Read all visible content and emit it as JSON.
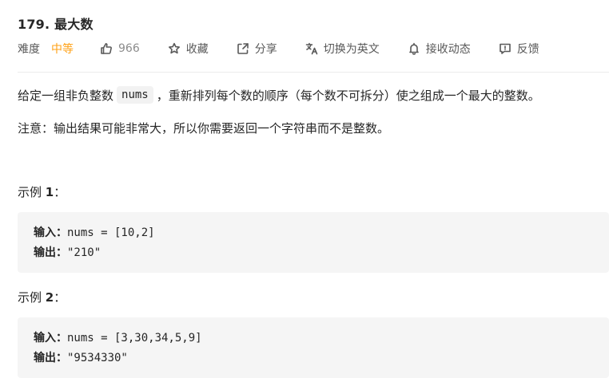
{
  "problem": {
    "title": "179. 最大数"
  },
  "toolbar": {
    "difficulty_label": "难度",
    "difficulty_value": "中等",
    "like_count": "966",
    "favorite_label": "收藏",
    "share_label": "分享",
    "translate_label": "切换为英文",
    "subscribe_label": "接收动态",
    "feedback_label": "反馈"
  },
  "description": {
    "part1": "给定一组非负整数",
    "code": "nums",
    "part2": "，重新排列每个数的顺序（每个数不可拆分）使之组成一个最大的整数。",
    "note": "注意：输出结果可能非常大，所以你需要返回一个字符串而不是整数。"
  },
  "examples": [
    {
      "title_prefix": "示例 ",
      "title_num": "1",
      "title_suffix": "：",
      "input_label": "输入：",
      "input_value": "nums = [10,2]",
      "output_label": "输出：",
      "output_value": "\"210\""
    },
    {
      "title_prefix": "示例 ",
      "title_num": "2",
      "title_suffix": "：",
      "input_label": "输入：",
      "input_value": "nums = [3,30,34,5,9]",
      "output_label": "输出：",
      "output_value": "\"9534330\""
    }
  ],
  "icons": {
    "like": "thumbs-up-icon",
    "favorite": "star-icon",
    "share": "share-icon",
    "translate": "translate-icon",
    "subscribe": "bell-icon",
    "feedback": "feedback-icon"
  },
  "colors": {
    "difficulty_medium": "#ffa116",
    "text": "#262626",
    "muted": "#595959",
    "code_bg": "#f5f5f5"
  }
}
